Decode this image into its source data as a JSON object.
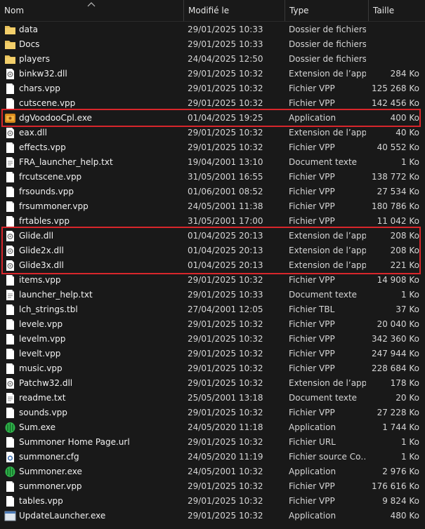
{
  "columns": {
    "name": "Nom",
    "modified": "Modifié le",
    "type": "Type",
    "size": "Taille"
  },
  "files": [
    {
      "name": "data",
      "modified": "29/01/2025 10:33",
      "type": "Dossier de fichiers",
      "size": "",
      "icon": "folder-icon"
    },
    {
      "name": "Docs",
      "modified": "29/01/2025 10:33",
      "type": "Dossier de fichiers",
      "size": "",
      "icon": "folder-icon"
    },
    {
      "name": "players",
      "modified": "24/04/2025 12:50",
      "type": "Dossier de fichiers",
      "size": "",
      "icon": "folder-icon"
    },
    {
      "name": "binkw32.dll",
      "modified": "29/01/2025 10:32",
      "type": "Extension de l’app…",
      "size": "284 Ko",
      "icon": "dll-icon"
    },
    {
      "name": "chars.vpp",
      "modified": "29/01/2025 10:32",
      "type": "Fichier VPP",
      "size": "125 268 Ko",
      "icon": "file-icon"
    },
    {
      "name": "cutscene.vpp",
      "modified": "29/01/2025 10:32",
      "type": "Fichier VPP",
      "size": "142 456 Ko",
      "icon": "file-icon"
    },
    {
      "name": "dgVoodooCpl.exe",
      "modified": "01/04/2025 19:25",
      "type": "Application",
      "size": "400 Ko",
      "icon": "dgvoodoo-icon"
    },
    {
      "name": "eax.dll",
      "modified": "29/01/2025 10:32",
      "type": "Extension de l’app…",
      "size": "40 Ko",
      "icon": "dll-icon"
    },
    {
      "name": "effects.vpp",
      "modified": "29/01/2025 10:32",
      "type": "Fichier VPP",
      "size": "40 552 Ko",
      "icon": "file-icon"
    },
    {
      "name": "FRA_launcher_help.txt",
      "modified": "19/04/2001 13:10",
      "type": "Document texte",
      "size": "1 Ko",
      "icon": "text-file-icon"
    },
    {
      "name": "frcutscene.vpp",
      "modified": "31/05/2001 16:55",
      "type": "Fichier VPP",
      "size": "138 772 Ko",
      "icon": "file-icon"
    },
    {
      "name": "frsounds.vpp",
      "modified": "01/06/2001 08:52",
      "type": "Fichier VPP",
      "size": "27 534 Ko",
      "icon": "file-icon"
    },
    {
      "name": "frsummoner.vpp",
      "modified": "24/05/2001 11:38",
      "type": "Fichier VPP",
      "size": "180 786 Ko",
      "icon": "file-icon"
    },
    {
      "name": "frtables.vpp",
      "modified": "31/05/2001 17:00",
      "type": "Fichier VPP",
      "size": "11 042 Ko",
      "icon": "file-icon"
    },
    {
      "name": "Glide.dll",
      "modified": "01/04/2025 20:13",
      "type": "Extension de l’app…",
      "size": "208 Ko",
      "icon": "dll-icon"
    },
    {
      "name": "Glide2x.dll",
      "modified": "01/04/2025 20:13",
      "type": "Extension de l’app…",
      "size": "208 Ko",
      "icon": "dll-icon"
    },
    {
      "name": "Glide3x.dll",
      "modified": "01/04/2025 20:13",
      "type": "Extension de l’app…",
      "size": "221 Ko",
      "icon": "dll-icon"
    },
    {
      "name": "items.vpp",
      "modified": "29/01/2025 10:32",
      "type": "Fichier VPP",
      "size": "14 908 Ko",
      "icon": "file-icon"
    },
    {
      "name": "launcher_help.txt",
      "modified": "29/01/2025 10:33",
      "type": "Document texte",
      "size": "1 Ko",
      "icon": "text-file-icon"
    },
    {
      "name": "lch_strings.tbl",
      "modified": "27/04/2001 12:05",
      "type": "Fichier TBL",
      "size": "37 Ko",
      "icon": "file-icon"
    },
    {
      "name": "levele.vpp",
      "modified": "29/01/2025 10:32",
      "type": "Fichier VPP",
      "size": "20 040 Ko",
      "icon": "file-icon"
    },
    {
      "name": "levelm.vpp",
      "modified": "29/01/2025 10:32",
      "type": "Fichier VPP",
      "size": "342 360 Ko",
      "icon": "file-icon"
    },
    {
      "name": "levelt.vpp",
      "modified": "29/01/2025 10:32",
      "type": "Fichier VPP",
      "size": "247 944 Ko",
      "icon": "file-icon"
    },
    {
      "name": "music.vpp",
      "modified": "29/01/2025 10:32",
      "type": "Fichier VPP",
      "size": "228 684 Ko",
      "icon": "file-icon"
    },
    {
      "name": "Patchw32.dll",
      "modified": "29/01/2025 10:32",
      "type": "Extension de l’app…",
      "size": "178 Ko",
      "icon": "dll-icon"
    },
    {
      "name": "readme.txt",
      "modified": "25/05/2001 13:18",
      "type": "Document texte",
      "size": "20 Ko",
      "icon": "text-file-icon"
    },
    {
      "name": "sounds.vpp",
      "modified": "29/01/2025 10:32",
      "type": "Fichier VPP",
      "size": "27 228 Ko",
      "icon": "file-icon"
    },
    {
      "name": "Sum.exe",
      "modified": "24/05/2020 11:18",
      "type": "Application",
      "size": "1 744 Ko",
      "icon": "summoner-app-icon"
    },
    {
      "name": "Summoner Home Page.url",
      "modified": "29/01/2025 10:32",
      "type": "Fichier URL",
      "size": "1 Ko",
      "icon": "file-icon"
    },
    {
      "name": "summoner.cfg",
      "modified": "24/05/2020 11:19",
      "type": "Fichier source Co…",
      "size": "1 Ko",
      "icon": "config-file-icon"
    },
    {
      "name": "Summoner.exe",
      "modified": "24/05/2001 10:32",
      "type": "Application",
      "size": "2 976 Ko",
      "icon": "summoner-app-icon"
    },
    {
      "name": "summoner.vpp",
      "modified": "29/01/2025 10:32",
      "type": "Fichier VPP",
      "size": "176 616 Ko",
      "icon": "file-icon"
    },
    {
      "name": "tables.vpp",
      "modified": "29/01/2025 10:32",
      "type": "Fichier VPP",
      "size": "9 824 Ko",
      "icon": "file-icon"
    },
    {
      "name": "UpdateLauncher.exe",
      "modified": "29/01/2025 10:32",
      "type": "Application",
      "size": "480 Ko",
      "icon": "app-icon"
    }
  ],
  "highlights": [
    [
      6,
      6
    ],
    [
      14,
      16
    ]
  ],
  "colors": {
    "background": "#191919",
    "text": "#f2f2f2",
    "highlight_border": "#d8262b",
    "folder": "#e8c15a",
    "summoner_green": "#2fb34a"
  }
}
